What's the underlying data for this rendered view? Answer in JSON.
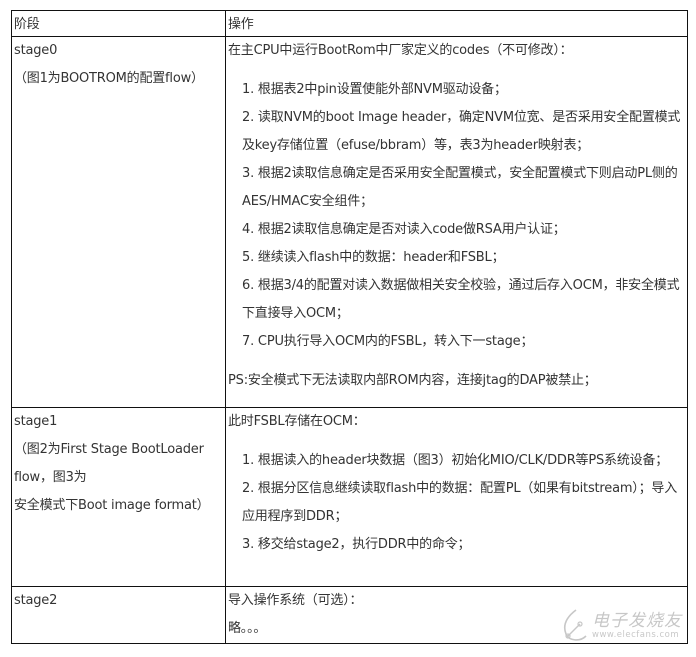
{
  "table": {
    "headers": {
      "stage": "阶段",
      "operation": "操作"
    },
    "rows": [
      {
        "stage_lines": [
          "stage0",
          "（图1为BOOTROM的配置flow）"
        ],
        "intro": "在主CPU中运行BootRom中厂家定义的codes（不可修改）：",
        "steps": [
          "1. 根据表2中pin设置使能外部NVM驱动设备；",
          "2. 读取NVM的boot Image header，确定NVM位宽、是否采用安全配置模式及key存储位置（efuse/bbram）等，表3为header映射表；",
          "3. 根据2读取信息确定是否采用安全配置模式，安全配置模式下则启动PL侧的AES/HMAC安全组件；",
          "4. 根据2读取信息确定是否对读入code做RSA用户认证；",
          "5. 继续读入flash中的数据：header和FSBL；",
          "6. 根据3/4的配置对读入数据做相关安全校验，通过后存入OCM，非安全模式下直接导入OCM；",
          "7. CPU执行导入OCM内的FSBL，转入下一stage；"
        ],
        "note": "PS:安全模式下无法读取内部ROM内容，连接jtag的DAP被禁止；"
      },
      {
        "stage_lines": [
          "stage1",
          "（图2为First Stage BootLoader",
          "flow，图3为",
          "安全模式下Boot image format）"
        ],
        "intro": "此时FSBL存储在OCM：",
        "steps": [
          "1. 根据读入的header块数据（图3）初始化MIO/CLK/DDR等PS系统设备；",
          "2. 根据分区信息继续读取flash中的数据：配置PL（如果有bitstream）；导入应用程序到DDR；",
          "3. 移交给stage2，执行DDR中的命令；"
        ]
      },
      {
        "stage_lines": [
          "stage2"
        ],
        "intro": "导入操作系统（可选）：",
        "body": "略。。。"
      }
    ]
  },
  "watermark": {
    "title": "电子发烧友",
    "url": "www.elecfans.com"
  }
}
